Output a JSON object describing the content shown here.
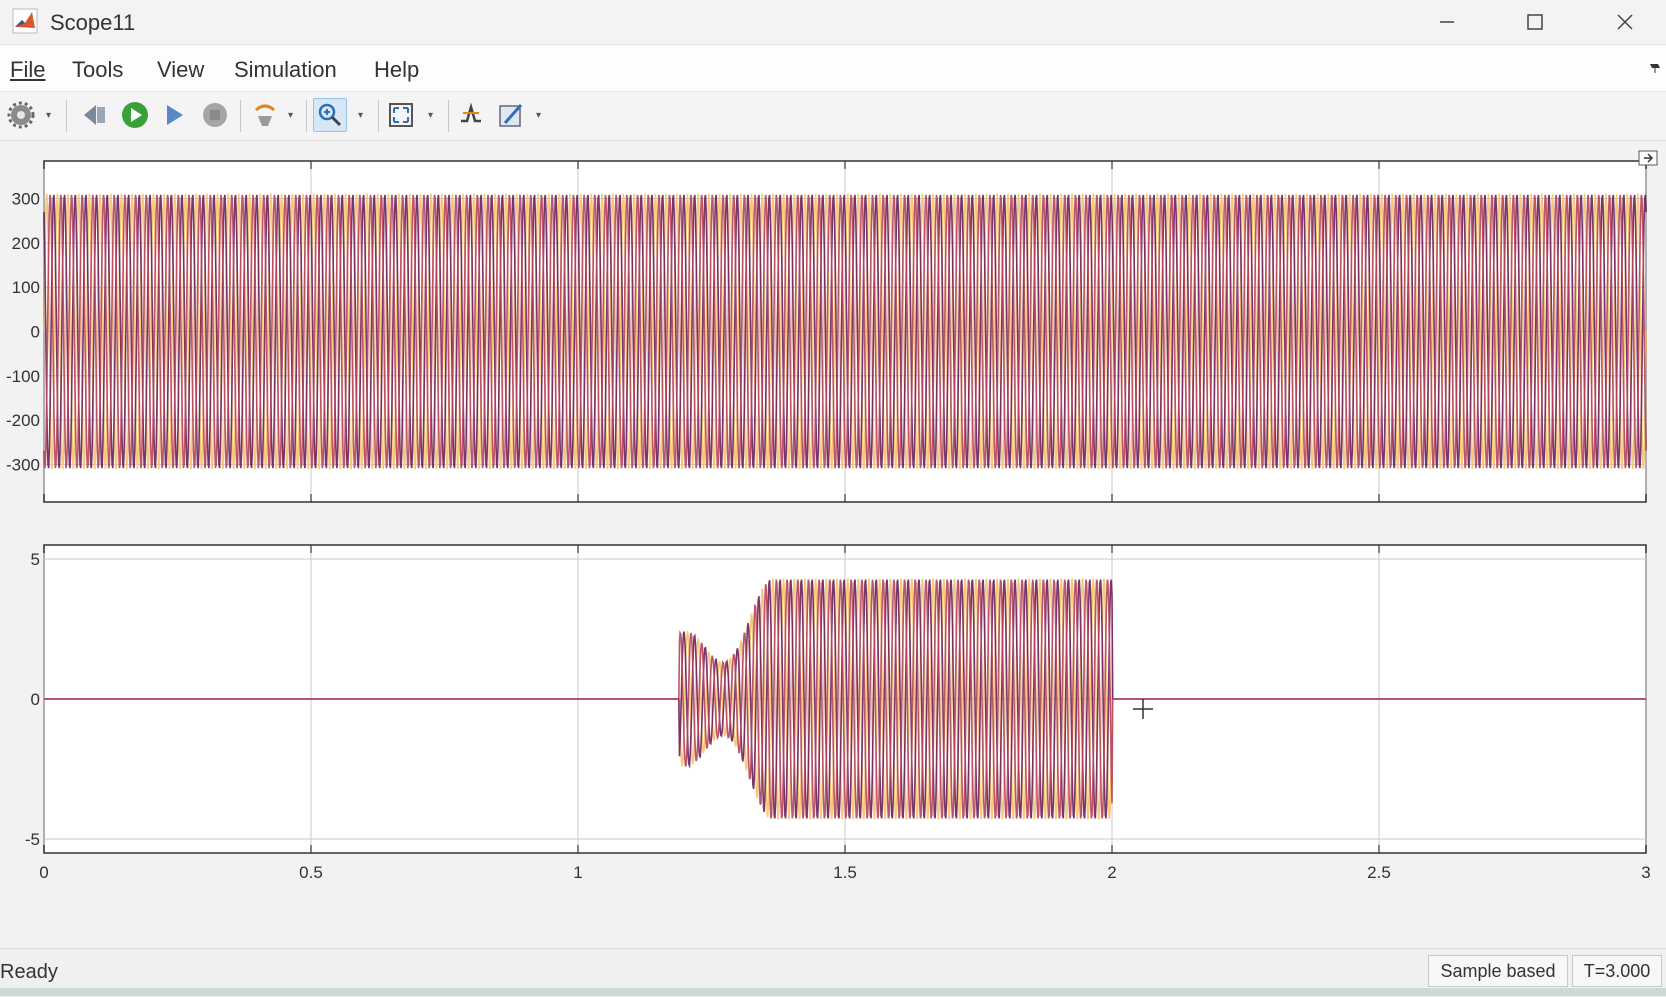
{
  "window": {
    "title": "Scope11"
  },
  "menu": {
    "items": [
      "File",
      "Tools",
      "View",
      "Simulation",
      "Help"
    ]
  },
  "toolbar": {
    "icons": [
      "settings-icon",
      "step-back-icon",
      "run-icon",
      "step-forward-icon",
      "stop-icon",
      "highlight-icon",
      "zoom-icon",
      "fit-icon",
      "trigger-icon",
      "style-icon"
    ],
    "active": "zoom-icon"
  },
  "chart_data": [
    {
      "type": "line",
      "title": "",
      "xlabel": "",
      "ylabel": "",
      "xlim": [
        0,
        3
      ],
      "ylim": [
        -385,
        385
      ],
      "yticks": [
        "300",
        "200",
        "100",
        "0",
        "-100",
        "-200",
        "-300"
      ],
      "xticks": [
        "0",
        "0.5",
        "1",
        "1.5",
        "2",
        "2.5",
        "3"
      ],
      "grid": true,
      "series": [
        {
          "description": "three-phase sinusoid, amplitude ~311, 50 Hz, full span 0-3 s",
          "amplitude": 311,
          "frequency_hz": 50,
          "t_start": 0,
          "t_end": 3
        }
      ]
    },
    {
      "type": "line",
      "title": "",
      "xlabel": "",
      "ylabel": "",
      "xlim": [
        0,
        3
      ],
      "ylim": [
        -5.5,
        5.5
      ],
      "yticks": [
        "5",
        "0",
        "-5"
      ],
      "xticks": [
        "0",
        "0.5",
        "1",
        "1.5",
        "2",
        "2.5",
        "3"
      ],
      "grid": true,
      "series": [
        {
          "description": "three-phase current, zero until ~1.2 s, transient then amplitude ~4.3 until 2.0 s, zero afterwards",
          "amplitude": 4.3,
          "t_start": 1.19,
          "t_settle": 1.36,
          "t_end": 2.0
        }
      ]
    }
  ],
  "colors": {
    "phase_a": "#f2c46a",
    "phase_b": "#6b1f5a",
    "phase_c": "#b8435a",
    "accent": "#2f6fb6"
  },
  "status": {
    "ready": "Ready",
    "mode": "Sample based",
    "time": "T=3.000"
  }
}
